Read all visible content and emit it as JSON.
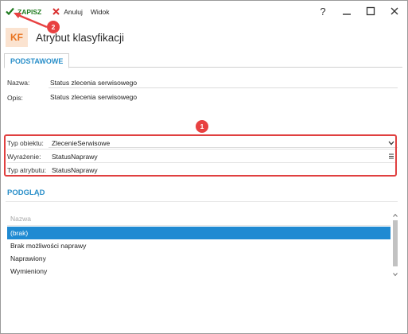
{
  "toolbar": {
    "save_label": "ZAPISZ",
    "cancel_label": "Anuluj",
    "view_label": "Widok",
    "help_label": "?"
  },
  "header": {
    "badge": "KF",
    "title": "Atrybut klasyfikacji"
  },
  "tabs": [
    {
      "label": "PODSTAWOWE",
      "active": true
    }
  ],
  "form": {
    "name_label": "Nazwa:",
    "name_value": "Status zlecenia serwisowego",
    "description_label": "Opis:",
    "description_value": "Status zlecenia serwisowego",
    "object_type_label": "Typ obiektu:",
    "object_type_value": "ZlecenieSerwisowe",
    "expression_label": "Wyrażenie:",
    "expression_value": "StatusNaprawy",
    "attribute_type_label": "Typ atrybutu:",
    "attribute_type_value": "StatusNaprawy"
  },
  "callouts": {
    "one": "1",
    "two": "2"
  },
  "preview": {
    "title": "PODGLĄD",
    "column_header": "Nazwa",
    "items": [
      "(brak)",
      "Brak możliwości naprawy",
      "Naprawiony",
      "Wymieniony"
    ],
    "selected_index": 0
  },
  "colors": {
    "accent": "#2a8fc9",
    "save_green": "#1e7a1e",
    "cancel_red": "#d93030",
    "highlight_red": "#e04040",
    "selection": "#1f8ad2",
    "badge_bg": "#fbe3d0",
    "badge_text": "#e8721e"
  }
}
